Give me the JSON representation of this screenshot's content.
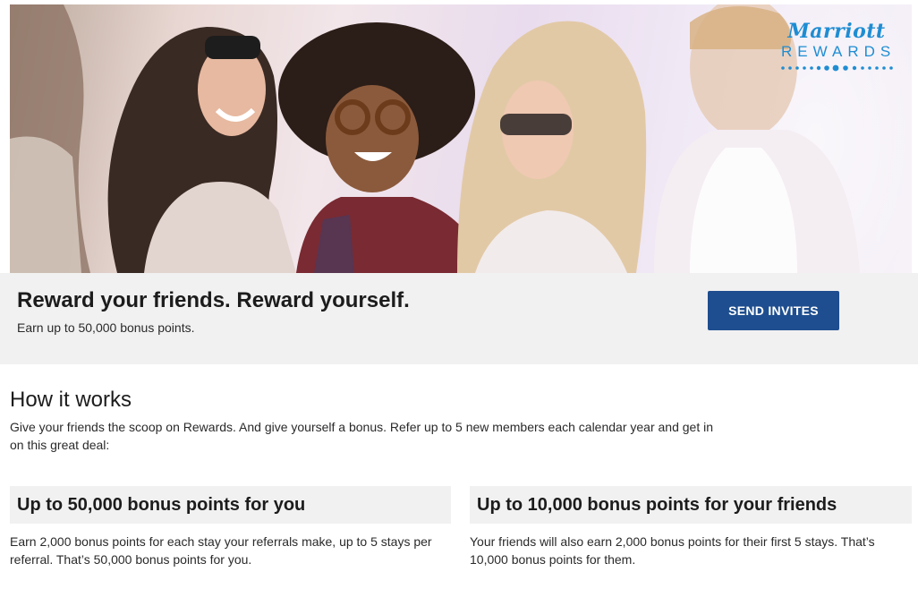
{
  "hero": {
    "logo_brand": "Marriott",
    "logo_word": "REWARDS"
  },
  "cta": {
    "title": "Reward your friends. Reward yourself.",
    "subtitle": "Earn up to 50,000 bonus points.",
    "button_label": "SEND INVITES"
  },
  "how_it_works": {
    "title": "How it works",
    "description": "Give your friends the scoop on Rewards. And give yourself a bonus. Refer up to 5 new members each calendar year and get in on this great deal:"
  },
  "cards": [
    {
      "heading": "Up to 50,000 bonus points for you",
      "body": "Earn 2,000 bonus points for each stay your referrals make, up to 5 stays per referral. That’s 50,000 bonus points for you."
    },
    {
      "heading": "Up to 10,000 bonus points for your friends",
      "body": "Your friends will also earn 2,000 bonus points for their first 5 stays. That’s 10,000 bonus points for them."
    }
  ],
  "colors": {
    "button": "#1e4e8f",
    "logo": "#1f8dd2",
    "band": "#f1f1f1"
  }
}
